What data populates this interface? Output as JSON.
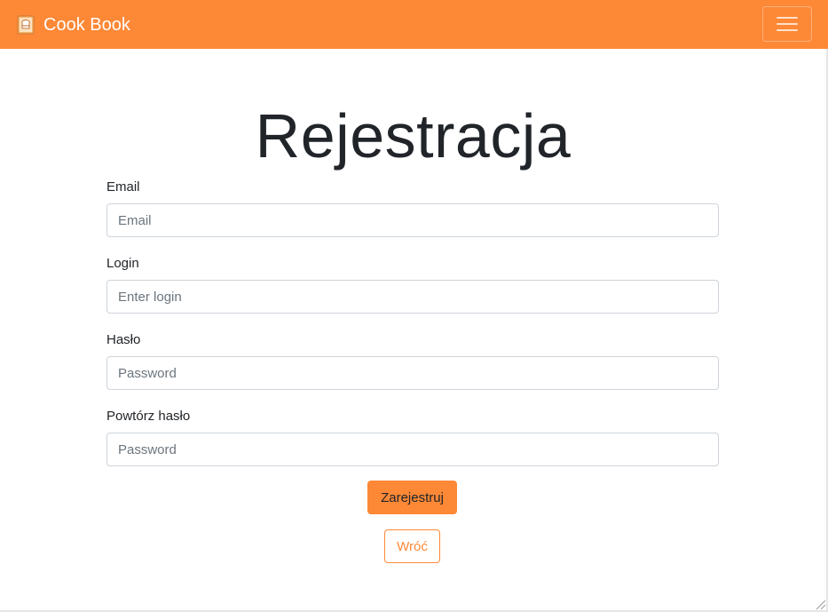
{
  "navbar": {
    "brand_text": "Cook Book",
    "brand_icon": "cookbook-icon",
    "toggler_icon": "hamburger-menu-icon",
    "color": "#fd8836"
  },
  "form": {
    "title": "Rejestracja",
    "email": {
      "label": "Email",
      "placeholder": "Email",
      "value": ""
    },
    "login": {
      "label": "Login",
      "placeholder": "Enter login",
      "value": ""
    },
    "password": {
      "label": "Hasło",
      "placeholder": "Password",
      "value": ""
    },
    "password_repeat": {
      "label": "Powtórz hasło",
      "placeholder": "Password",
      "value": ""
    },
    "submit_label": "Zarejestruj",
    "back_label": "Wróć"
  },
  "colors": {
    "accent": "#fd8836",
    "text": "#212529",
    "placeholder": "#6c757d",
    "input_border": "#ced4da"
  }
}
